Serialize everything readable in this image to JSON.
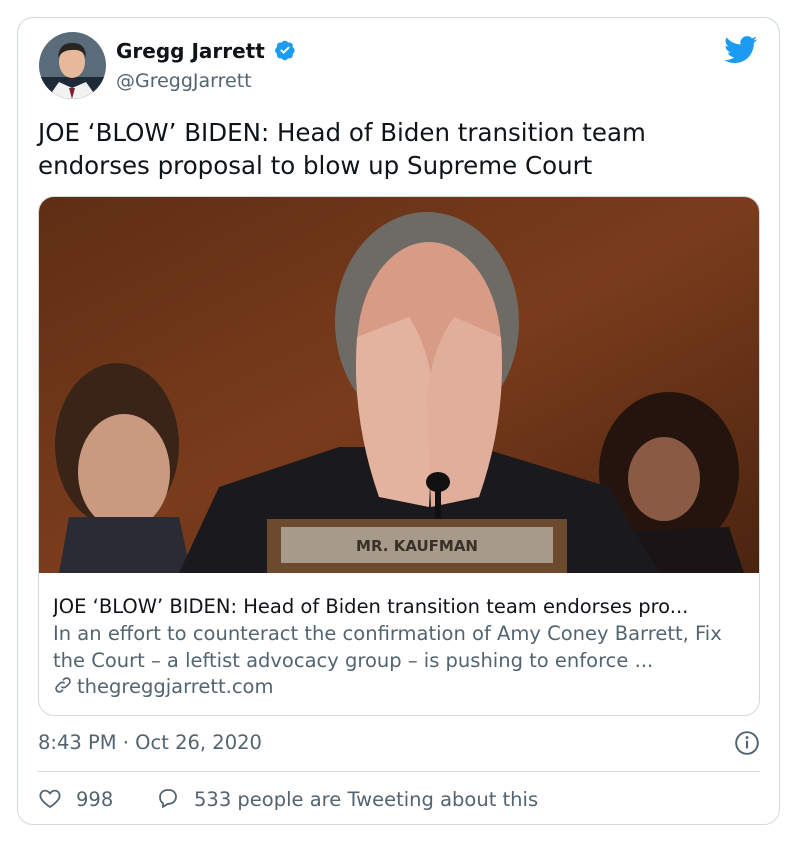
{
  "author": {
    "name": "Gregg Jarrett",
    "handle": "@GreggJarrett",
    "verified": true
  },
  "tweet": {
    "text": "JOE ‘BLOW’ BIDEN: Head of Biden transition team endorses proposal to blow up Supreme Court",
    "timestamp": "8:43 PM · Oct 26, 2020"
  },
  "link_card": {
    "image_label": "MR. KAUFMAN",
    "title": "JOE ‘BLOW’ BIDEN: Head of Biden transition team endorses pro...",
    "description": "In an effort to counteract the confirmation of Amy Coney Barrett, Fix the Court – a leftist advocacy group – is pushing to enforce ...",
    "domain": "thegreggjarrett.com"
  },
  "engagement": {
    "likes": "998",
    "replies_text": "533 people are Tweeting about this"
  },
  "icons": {
    "verified": "verified-badge-icon",
    "brand": "twitter-bird-icon",
    "link": "link-icon",
    "info": "info-icon",
    "like": "heart-icon",
    "reply": "speech-bubble-icon"
  },
  "colors": {
    "brand_blue": "#1d9bf0",
    "text_primary": "#0f1419",
    "text_secondary": "#536471",
    "border": "#cfd9de"
  }
}
